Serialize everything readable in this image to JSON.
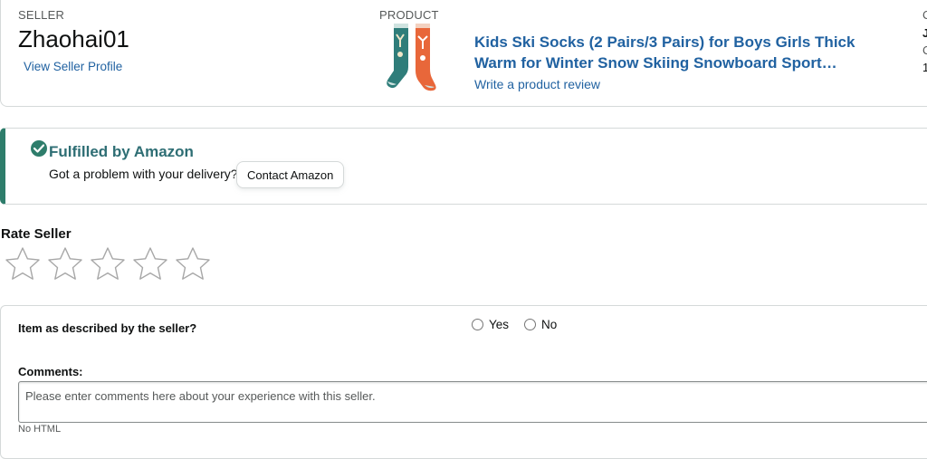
{
  "seller": {
    "heading": "SELLER",
    "name": "Zhaohai01",
    "profile_link": "View Seller Profile"
  },
  "product": {
    "heading": "PRODUCT",
    "title": "Kids Ski Socks (2 Pairs/3 Pairs) for Boys Girls Thick Warm for Winter Snow Skiing Snowboard Sport…",
    "review_link": "Write a product review",
    "image_icon": "ski-socks-image"
  },
  "edge": {
    "line1": "C",
    "line2": "J",
    "line3": "C",
    "line4": "1"
  },
  "fulfilled": {
    "title": "Fulfilled by Amazon",
    "question": "Got a problem with your delivery?",
    "contact_button": "Contact Amazon",
    "accent_color": "#2e7d6b"
  },
  "rating": {
    "title": "Rate Seller",
    "max_stars": 5,
    "selected_stars": 0
  },
  "questions": {
    "item_described": "Item as described by the seller?",
    "options": [
      "Yes",
      "No"
    ],
    "comments_label": "Comments:",
    "comments_placeholder": "Please enter comments here about your experience with this seller.",
    "no_html": "No HTML"
  },
  "colors": {
    "link": "#2162a1",
    "text": "#0f1111",
    "border": "#d5d9d9"
  }
}
